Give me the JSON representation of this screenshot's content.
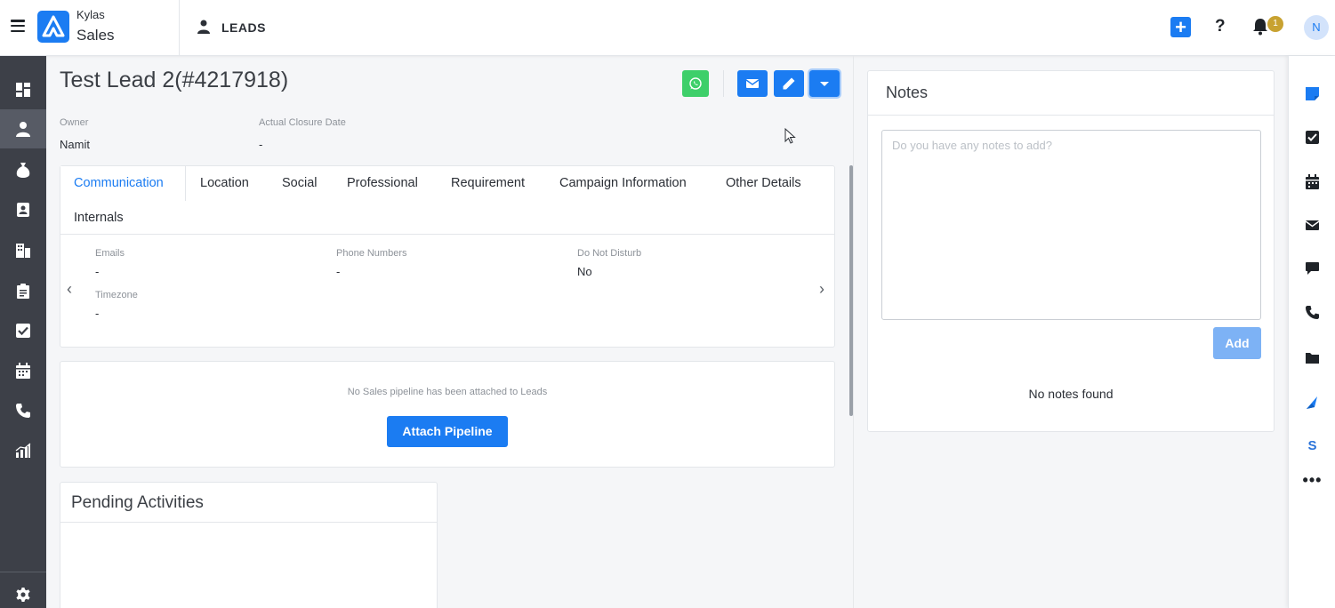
{
  "header": {
    "brand_top": "Kylas",
    "brand_bottom": "Sales",
    "section": "LEADS",
    "notification_count": "1",
    "avatar_initial": "N"
  },
  "sidebar": {
    "items": [
      {
        "icon": "dashboard-icon"
      },
      {
        "icon": "leads-icon",
        "active": true
      },
      {
        "icon": "deals-icon"
      },
      {
        "icon": "contacts-icon"
      },
      {
        "icon": "companies-icon"
      },
      {
        "icon": "clipboard-icon"
      },
      {
        "icon": "tasks-icon"
      },
      {
        "icon": "calendar-icon"
      },
      {
        "icon": "phone-icon"
      },
      {
        "icon": "reports-icon"
      }
    ],
    "settings_icon": "gear-icon"
  },
  "lead": {
    "title": "Test Lead 2(#4217918)",
    "owner_label": "Owner",
    "owner_value": "Namit",
    "closure_label": "Actual Closure Date",
    "closure_value": "-"
  },
  "tabs": [
    {
      "label": "Communication",
      "active": true
    },
    {
      "label": "Location"
    },
    {
      "label": "Social"
    },
    {
      "label": "Professional"
    },
    {
      "label": "Requirement"
    },
    {
      "label": "Campaign Information"
    },
    {
      "label": "Other Details"
    },
    {
      "label": "Internals"
    }
  ],
  "communication": {
    "emails_label": "Emails",
    "emails_value": "-",
    "phones_label": "Phone Numbers",
    "phones_value": "-",
    "dnd_label": "Do Not Disturb",
    "dnd_value": "No",
    "timezone_label": "Timezone",
    "timezone_value": "-"
  },
  "pipeline": {
    "message": "No Sales pipeline has been attached to Leads",
    "button": "Attach Pipeline"
  },
  "pending": {
    "title": "Pending Activities"
  },
  "notes": {
    "title": "Notes",
    "placeholder": "Do you have any notes to add?",
    "add_button": "Add",
    "empty": "No notes found"
  },
  "colors": {
    "primary": "#1b7cf2",
    "whatsapp": "#3ecf6a",
    "sidebar": "#3d4048",
    "badge": "#c8a231"
  }
}
